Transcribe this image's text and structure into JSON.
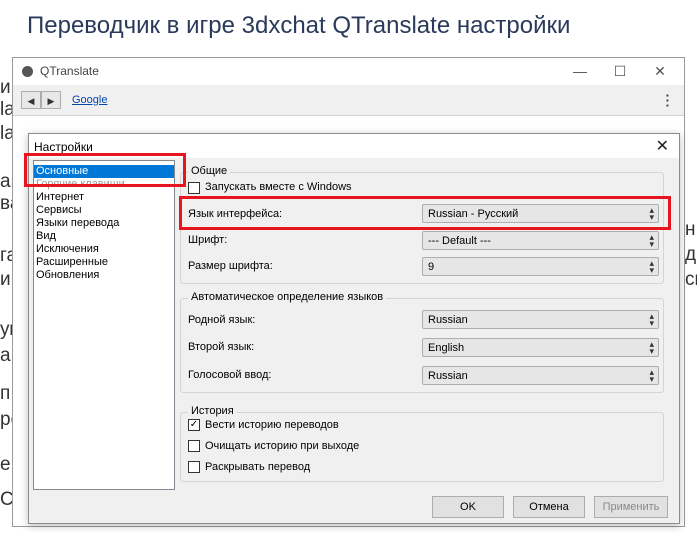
{
  "page": {
    "title": "Переводчик в игре 3dxchat QTranslate настройки",
    "bg_fragments": [
      "и",
      "la",
      "la",
      "ам",
      "ва",
      "га",
      "и",
      "ум",
      "а",
      "п",
      "ро",
      "е",
      "Сть",
      "н,",
      "да",
      "сь"
    ]
  },
  "window": {
    "title": "QTranslate",
    "minimize": "—",
    "maximize": "☐",
    "close": "✕",
    "back": "◀",
    "forward": "▶",
    "link": "Google",
    "menu": "⋮"
  },
  "dialog": {
    "title": "Настройки",
    "close": "✕",
    "sidebar": [
      "Основные",
      "Горячие клавиши",
      "Интернет",
      "Сервисы",
      "Языки перевода",
      "Вид",
      "Исключения",
      "Расширенные",
      "Обновления"
    ],
    "general": {
      "group_title": "Общие",
      "autostart": {
        "label": "Запускать вместе с Windows",
        "checked": false
      },
      "interface_lang": {
        "label": "Язык интерфейса:",
        "value": "Russian - Русский"
      },
      "font": {
        "label": "Шрифт:",
        "value": "--- Default ---"
      },
      "font_size": {
        "label": "Размер шрифта:",
        "value": "9"
      }
    },
    "auto_detect": {
      "group_title": "Автоматическое определение языков",
      "native": {
        "label": "Родной язык:",
        "value": "Russian"
      },
      "second": {
        "label": "Второй язык:",
        "value": "English"
      },
      "voice": {
        "label": "Голосовой ввод:",
        "value": "Russian"
      }
    },
    "history": {
      "group_title": "История",
      "keep": {
        "label": "Вести историю переводов",
        "checked": true
      },
      "clear": {
        "label": "Очищать историю при выходе",
        "checked": false
      },
      "expand": {
        "label": "Раскрывать перевод",
        "checked": false
      }
    },
    "buttons": {
      "ok": "OK",
      "cancel": "Отмена",
      "apply": "Применить"
    },
    "check_mark": "✓",
    "combo_arrow": "▴▾"
  },
  "colors": {
    "highlight": "#e8141e",
    "selection": "#0078d7"
  }
}
